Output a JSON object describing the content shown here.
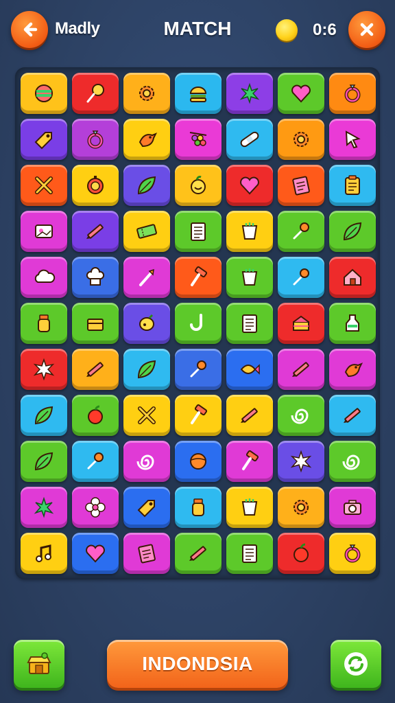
{
  "header": {
    "back_icon": "arrow-left-icon",
    "player_name": "Madly",
    "title": "MATCH",
    "coin_icon": "coin-icon",
    "timer": "0:6",
    "close_icon": "close-x-icon"
  },
  "board": {
    "rows": 11,
    "cols": 7,
    "tiles": [
      [
        {
          "icon": "candy-ball",
          "color": "#ffc21a"
        },
        {
          "icon": "lollipop",
          "color": "#ee2b2b"
        },
        {
          "icon": "sun-gear",
          "color": "#ffb01a"
        },
        {
          "icon": "burger",
          "color": "#2bb8ef"
        },
        {
          "icon": "leaf-splash",
          "color": "#8d3ee6"
        },
        {
          "icon": "heart",
          "color": "#5dc92a"
        },
        {
          "icon": "ring",
          "color": "#ff8a12"
        }
      ],
      [
        {
          "icon": "tag",
          "color": "#7a3ee6"
        },
        {
          "icon": "ring",
          "color": "#b43fd9"
        },
        {
          "icon": "bird",
          "color": "#ffcf12"
        },
        {
          "icon": "grapes",
          "color": "#ea3ad6"
        },
        {
          "icon": "bandage",
          "color": "#2fbaf0"
        },
        {
          "icon": "sun-gear",
          "color": "#ff9a12"
        },
        {
          "icon": "cursor-arrow",
          "color": "#ea3ad6"
        }
      ],
      [
        {
          "icon": "cross-tools",
          "color": "#ff5a1a"
        },
        {
          "icon": "timer-dial",
          "color": "#ffcf12"
        },
        {
          "icon": "leaf",
          "color": "#6a4ee6"
        },
        {
          "icon": "fruit-face",
          "color": "#ffc21a"
        },
        {
          "icon": "heart",
          "color": "#ee2b2b"
        },
        {
          "icon": "note-pad",
          "color": "#ff5a1a"
        },
        {
          "icon": "clipboard",
          "color": "#2fbaf0"
        }
      ],
      [
        {
          "icon": "frame",
          "color": "#e03ad6"
        },
        {
          "icon": "pencil",
          "color": "#7a3ee6"
        },
        {
          "icon": "ticket",
          "color": "#ffcf12"
        },
        {
          "icon": "document",
          "color": "#5dc92a"
        },
        {
          "icon": "cup",
          "color": "#ffcf12"
        },
        {
          "icon": "pin",
          "color": "#5dc92a"
        },
        {
          "icon": "leaf",
          "color": "#5dc92a"
        }
      ],
      [
        {
          "icon": "cloud",
          "color": "#e03ad6"
        },
        {
          "icon": "chef-hat",
          "color": "#3a6ee6"
        },
        {
          "icon": "pen-brush",
          "color": "#e03ad6"
        },
        {
          "icon": "hammer",
          "color": "#ff5a1a"
        },
        {
          "icon": "cup",
          "color": "#5dc92a"
        },
        {
          "icon": "pin",
          "color": "#2fbaf0"
        },
        {
          "icon": "house",
          "color": "#ee2b2b"
        }
      ],
      [
        {
          "icon": "jar",
          "color": "#5dc92a"
        },
        {
          "icon": "box",
          "color": "#5dc92a"
        },
        {
          "icon": "lemon",
          "color": "#6a4ee6"
        },
        {
          "icon": "hook",
          "color": "#5dc92a"
        },
        {
          "icon": "document",
          "color": "#5dc92a"
        },
        {
          "icon": "cake",
          "color": "#ee2b2b"
        },
        {
          "icon": "bottle",
          "color": "#5dc92a"
        }
      ],
      [
        {
          "icon": "star-burst",
          "color": "#ee2b2b"
        },
        {
          "icon": "pencil",
          "color": "#ffb01a"
        },
        {
          "icon": "leaf",
          "color": "#2fbaf0"
        },
        {
          "icon": "pin",
          "color": "#3a6ee6"
        },
        {
          "icon": "fish",
          "color": "#2b6ef0"
        },
        {
          "icon": "pencil",
          "color": "#e03ad6"
        },
        {
          "icon": "bird",
          "color": "#e03ad6"
        }
      ],
      [
        {
          "icon": "leaf",
          "color": "#2fbaf0"
        },
        {
          "icon": "apple",
          "color": "#5dc92a"
        },
        {
          "icon": "cross-tools",
          "color": "#ffcf12"
        },
        {
          "icon": "hammer",
          "color": "#ffcf12"
        },
        {
          "icon": "pencil",
          "color": "#ffcf12"
        },
        {
          "icon": "spiral",
          "color": "#5dc92a"
        },
        {
          "icon": "pencil",
          "color": "#2fbaf0"
        }
      ],
      [
        {
          "icon": "leaf",
          "color": "#5dc92a"
        },
        {
          "icon": "pin",
          "color": "#2fbaf0"
        },
        {
          "icon": "spiral",
          "color": "#e03ad6"
        },
        {
          "icon": "ball",
          "color": "#2b6ef0"
        },
        {
          "icon": "hammer",
          "color": "#e03ad6"
        },
        {
          "icon": "star-burst",
          "color": "#6a4ee6"
        },
        {
          "icon": "spiral",
          "color": "#5dc92a"
        }
      ],
      [
        {
          "icon": "leaf-splash",
          "color": "#e03ad6"
        },
        {
          "icon": "flower",
          "color": "#e03ad6"
        },
        {
          "icon": "tag",
          "color": "#2b6ef0"
        },
        {
          "icon": "jar",
          "color": "#2fbaf0"
        },
        {
          "icon": "cup",
          "color": "#ffcf12"
        },
        {
          "icon": "sun-gear",
          "color": "#ffb01a"
        },
        {
          "icon": "camera",
          "color": "#e03ad6"
        }
      ],
      [
        {
          "icon": "music-note",
          "color": "#ffcf12"
        },
        {
          "icon": "heart",
          "color": "#2b6ef0"
        },
        {
          "icon": "note-pad",
          "color": "#e03ad6"
        },
        {
          "icon": "pencil",
          "color": "#5dc92a"
        },
        {
          "icon": "document",
          "color": "#5dc92a"
        },
        {
          "icon": "apple",
          "color": "#ee2b2b"
        },
        {
          "icon": "ring",
          "color": "#ffcf12"
        }
      ]
    ]
  },
  "footer": {
    "shop_icon": "shop-stall-icon",
    "country_label": "INDONDSIA",
    "refresh_icon": "refresh-icon"
  }
}
